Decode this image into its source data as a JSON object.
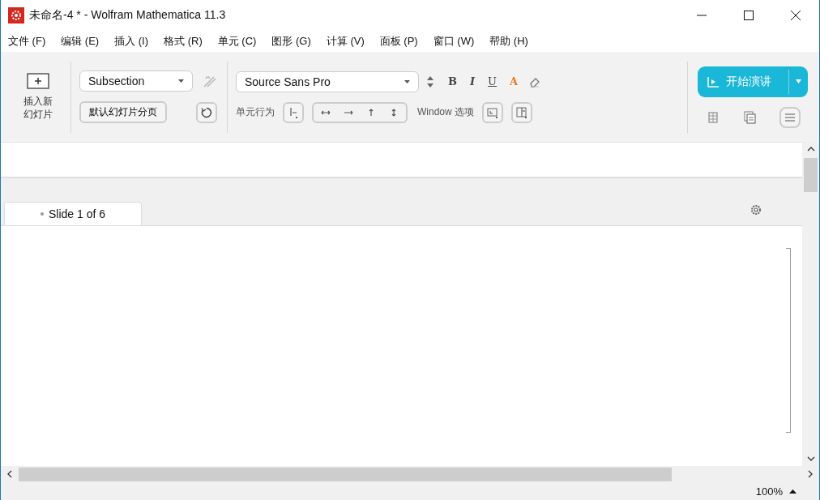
{
  "window": {
    "title": "未命名-4 * - Wolfram Mathematica 11.3"
  },
  "menu": [
    "文件 (F)",
    "编辑 (E)",
    "插入 (I)",
    "格式 (R)",
    "单元 (C)",
    "图形 (G)",
    "计算 (V)",
    "面板 (P)",
    "窗口 (W)",
    "帮助 (H)"
  ],
  "toolbar": {
    "insert_slide": "插入新幻灯片",
    "style_dropdown": "Subsection",
    "default_break_button": "默认幻灯片分页",
    "font_dropdown": "Source Sans Pro",
    "format_buttons": [
      {
        "label": "B",
        "kind": "bold"
      },
      {
        "label": "I",
        "kind": "italic"
      },
      {
        "label": "U",
        "kind": "underline"
      },
      {
        "label": "A",
        "kind": "color"
      }
    ],
    "cell_behavior_label": "单元行为",
    "window_options_label": "Window 选项",
    "present_button": "开始演讲"
  },
  "tabs": [
    {
      "label": "Slide 1 of 6",
      "selected": true
    }
  ],
  "status_bar": {
    "zoom": "100%"
  }
}
